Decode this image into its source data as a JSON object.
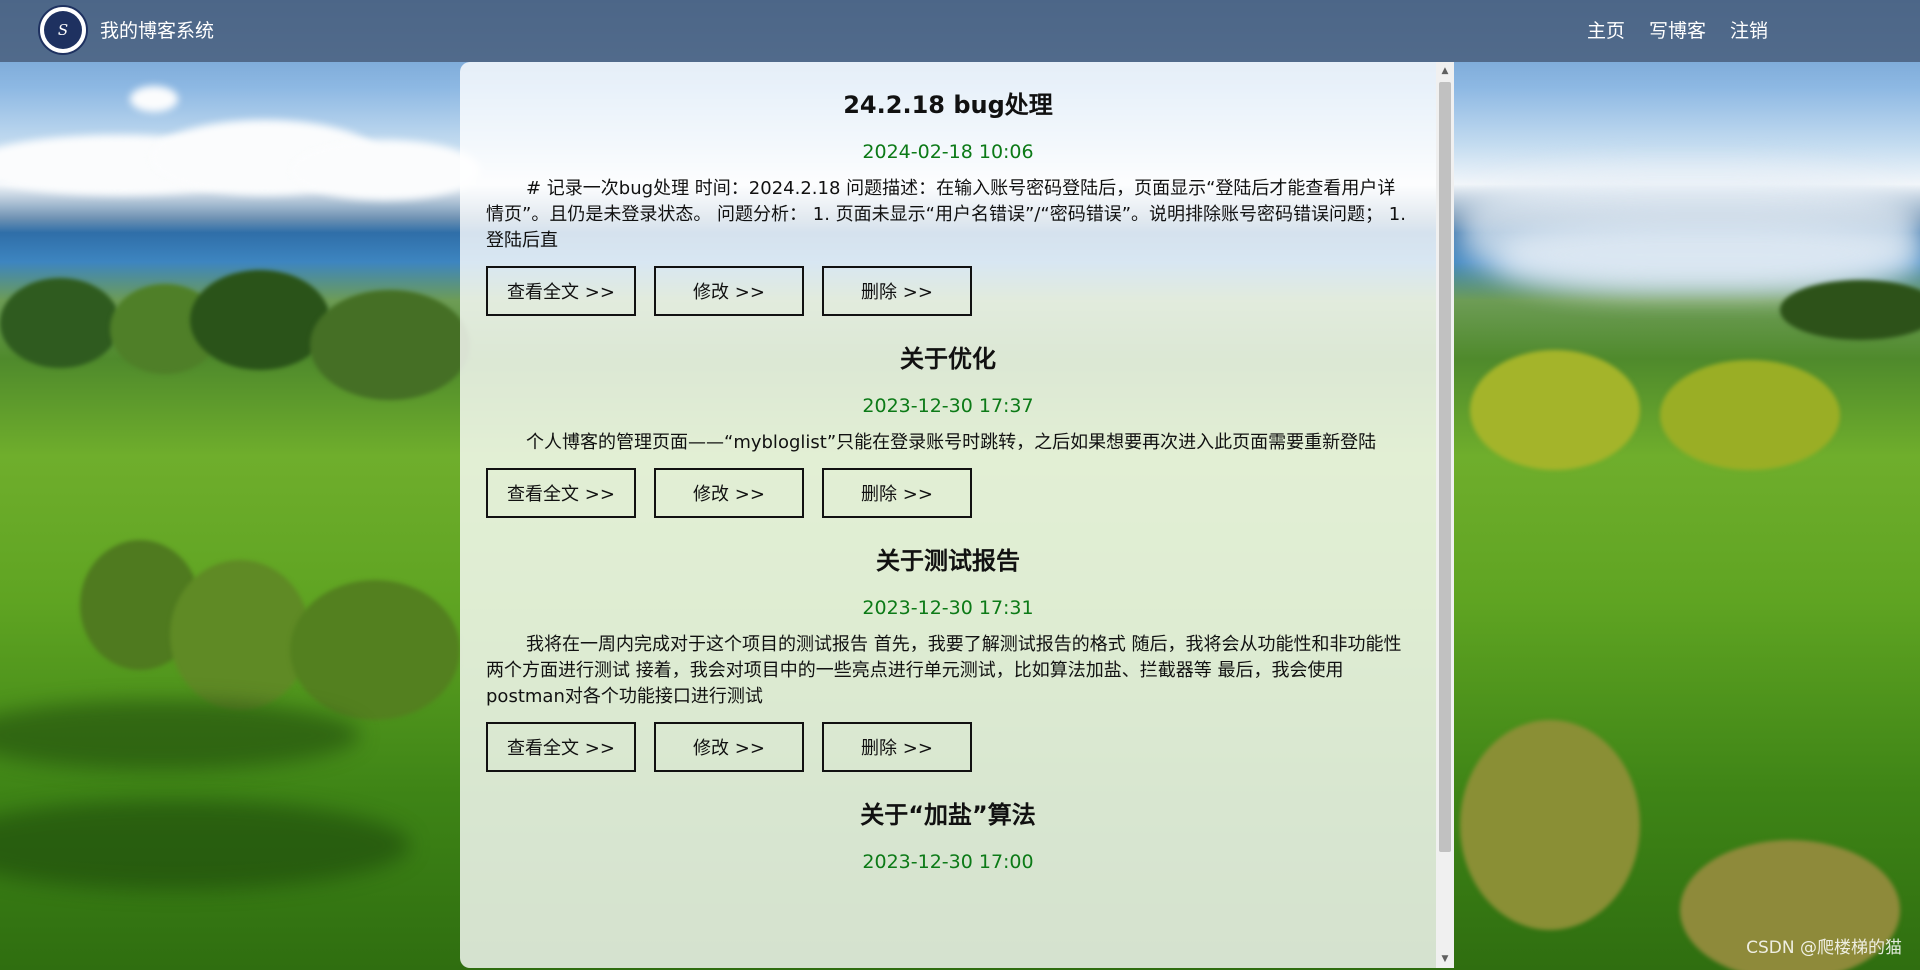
{
  "header": {
    "site_title": "我的博客系统",
    "nav": [
      {
        "label": "主页"
      },
      {
        "label": "写博客"
      },
      {
        "label": "注销"
      }
    ]
  },
  "blogs": [
    {
      "title": "24.2.18 bug处理",
      "date": "2024-02-18 10:06",
      "desc": "# 记录一次bug处理 时间：2024.2.18 问题描述：在输入账号密码登陆后，页面显示“登陆后才能查看用户详情页”。且仍是未登录状态。 问题分析： 1. 页面未显示“用户名错误”/“密码错误”。说明排除账号密码错误问题； 1. 登陆后直"
    },
    {
      "title": "关于优化",
      "date": "2023-12-30 17:37",
      "desc": "个人博客的管理页面——“mybloglist”只能在登录账号时跳转，之后如果想要再次进入此页面需要重新登陆"
    },
    {
      "title": "关于测试报告",
      "date": "2023-12-30 17:31",
      "desc": "我将在一周内完成对于这个项目的测试报告 首先，我要了解测试报告的格式 随后，我将会从功能性和非功能性两个方面进行测试 接着，我会对项目中的一些亮点进行单元测试，比如算法加盐、拦截器等 最后，我会使用postman对各个功能接口进行测试"
    },
    {
      "title": "关于“加盐”算法",
      "date": "2023-12-30 17:00",
      "desc": ""
    }
  ],
  "buttons": {
    "view": "查看全文 >>",
    "edit": "修改 >>",
    "delete": "删除 >>"
  },
  "scrollbar": {
    "up": "▲",
    "down": "▼"
  },
  "watermark": "CSDN @爬楼梯的猫",
  "colors": {
    "navbar": "#49607e",
    "date": "#0c7a17",
    "panel": "rgba(255,255,255,0.80)"
  }
}
